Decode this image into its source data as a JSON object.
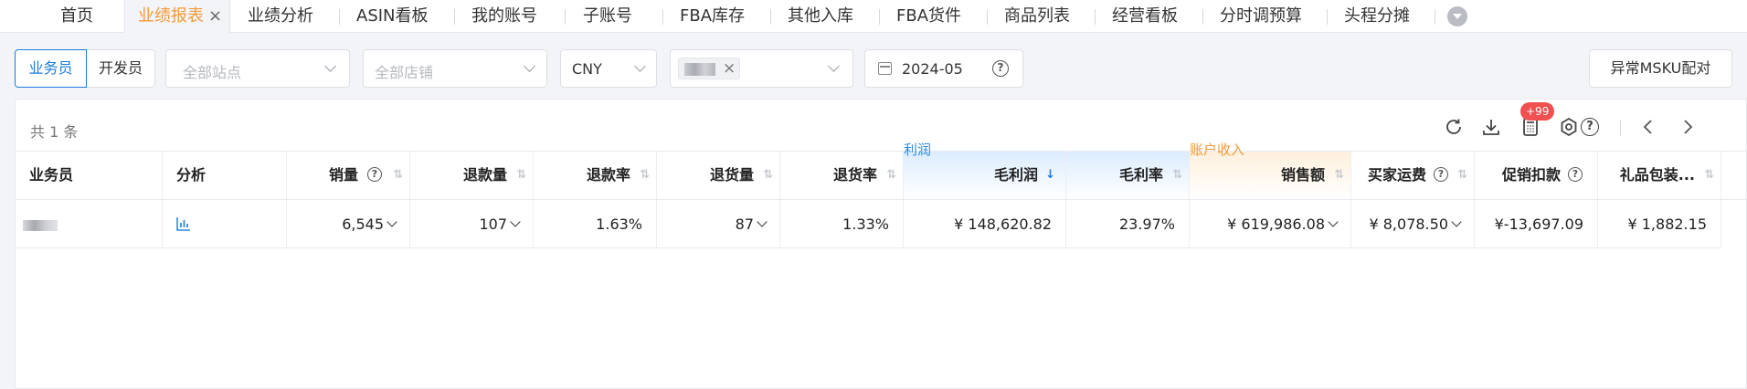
{
  "tabs": [
    {
      "label": "首页"
    },
    {
      "label": "业绩报表",
      "active": true,
      "close": "×"
    },
    {
      "label": "业绩分析"
    },
    {
      "label": "ASIN看板"
    },
    {
      "label": "我的账号"
    },
    {
      "label": "子账号"
    },
    {
      "label": "FBA库存"
    },
    {
      "label": "其他入库"
    },
    {
      "label": "FBA货件"
    },
    {
      "label": "商品列表"
    },
    {
      "label": "经营看板"
    },
    {
      "label": "分时调预算"
    },
    {
      "label": "头程分摊"
    }
  ],
  "filters": {
    "role_salesperson": "业务员",
    "role_developer": "开发员",
    "site_placeholder": "全部站点",
    "shop_placeholder": "全部店铺",
    "currency": "CNY",
    "date": "2024-05",
    "help_glyph": "?",
    "anomaly_button": "异常MSKU配对"
  },
  "toolbar": {
    "count_text": "共 1 条",
    "badge": "+99",
    "help_glyph": "?"
  },
  "table": {
    "group_profit": "利润",
    "group_income": "账户收入",
    "sort_glyph": "⇅",
    "sort_active_glyph": "↓",
    "help_glyph": "?",
    "headers": {
      "salesperson": "业务员",
      "analysis": "分析",
      "sales_qty": "销量",
      "refund_qty": "退款量",
      "refund_rate": "退款率",
      "return_qty": "退货量",
      "return_rate": "退货率",
      "gross_profit": "毛利润",
      "gross_margin": "毛利率",
      "sales_amount": "销售额",
      "buyer_shipping": "买家运费",
      "promo_discount": "促销扣款",
      "gift_wrap": "礼品包装..."
    },
    "rows": [
      {
        "sales_qty": "6,545",
        "refund_qty": "107",
        "refund_rate": "1.63%",
        "return_qty": "87",
        "return_rate": "1.33%",
        "gross_profit": "¥ 148,620.82",
        "gross_margin": "23.97%",
        "sales_amount": "¥ 619,986.08",
        "buyer_shipping": "¥ 8,078.50",
        "promo_discount": "¥-13,697.09",
        "gift_wrap": "¥ 1,882.15"
      }
    ]
  },
  "colors": {
    "accent_orange": "#f39a3a",
    "primary_blue": "#1a7bd9",
    "badge_red": "#f05050"
  }
}
